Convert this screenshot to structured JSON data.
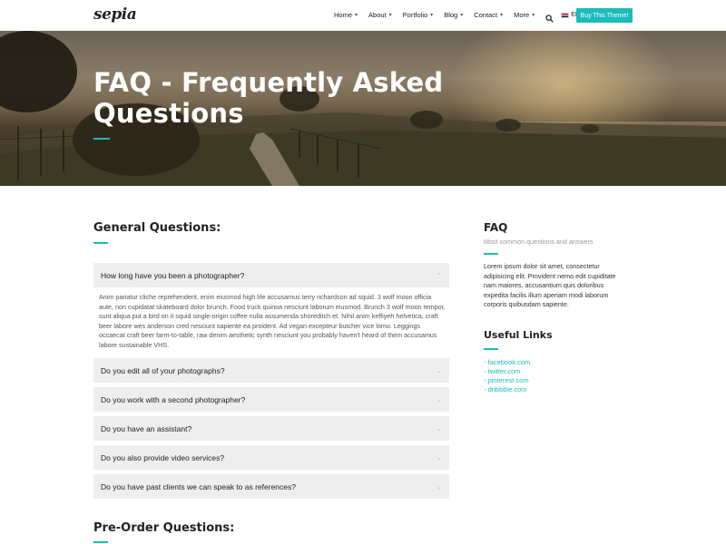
{
  "header": {
    "logo": "sepia",
    "nav": [
      {
        "label": "Home"
      },
      {
        "label": "About"
      },
      {
        "label": "Portfolio"
      },
      {
        "label": "Blog"
      },
      {
        "label": "Contact"
      },
      {
        "label": "More"
      }
    ],
    "lang": "EN",
    "buy_label": "Buy This Theme!"
  },
  "hero": {
    "title": "FAQ - Frequently Asked Questions"
  },
  "main": {
    "general_title": "General Questions:",
    "faq": [
      {
        "question": "How long have you been a photographer?",
        "expanded": true,
        "answer": "Anim pariatur cliche reprehenderit, enim eiusmod high life accusamus terry richardson ad squid. 3 wolf moon officia aute, non cupidatat skateboard dolor brunch. Food truck quinoa nesciunt laborum eiusmod. Brunch 3 wolf moon tempor, sunt aliqua put a bird on it squid single-origin coffee nulla assumenda shoreditch et. Nihil anim keffiyeh helvetica, craft beer labore wes anderson cred nesciunt sapiente ea proident. Ad vegan excepteur butcher vice lomo. Leggings occaecat craft beer farm-to-table, raw denim aesthetic synth nesciunt you probably haven't heard of them accusamus labore sustainable VHS."
      },
      {
        "question": "Do you edit all of your photographs?",
        "expanded": false
      },
      {
        "question": "Do you work with a second photographer?",
        "expanded": false
      },
      {
        "question": "Do you have an assistant?",
        "expanded": false
      },
      {
        "question": "Do you also provide video services?",
        "expanded": false
      },
      {
        "question": "Do you have past clients we can speak to as references?",
        "expanded": false
      }
    ],
    "preorder_title": "Pre-Order Questions:"
  },
  "sidebar": {
    "faq_title": "FAQ",
    "faq_subtitle": "Most common questions and answers",
    "faq_text": "Lorem ipsum dolor sit amet, consectetur adipisicing elit. Provident nemo edit cupiditate nam maiores, accusantium quis doloribus expedita facilis illum aperiam modi laborum corporis quibusdam sapiente.",
    "links_title": "Useful Links",
    "links": [
      {
        "label": "- facebook.com"
      },
      {
        "label": "- twitter.com"
      },
      {
        "label": "- pinterest.com"
      },
      {
        "label": "- dribbble.com"
      }
    ]
  },
  "colors": {
    "accent": "#1bbcbb",
    "accordion_bg": "#eeeeee"
  }
}
